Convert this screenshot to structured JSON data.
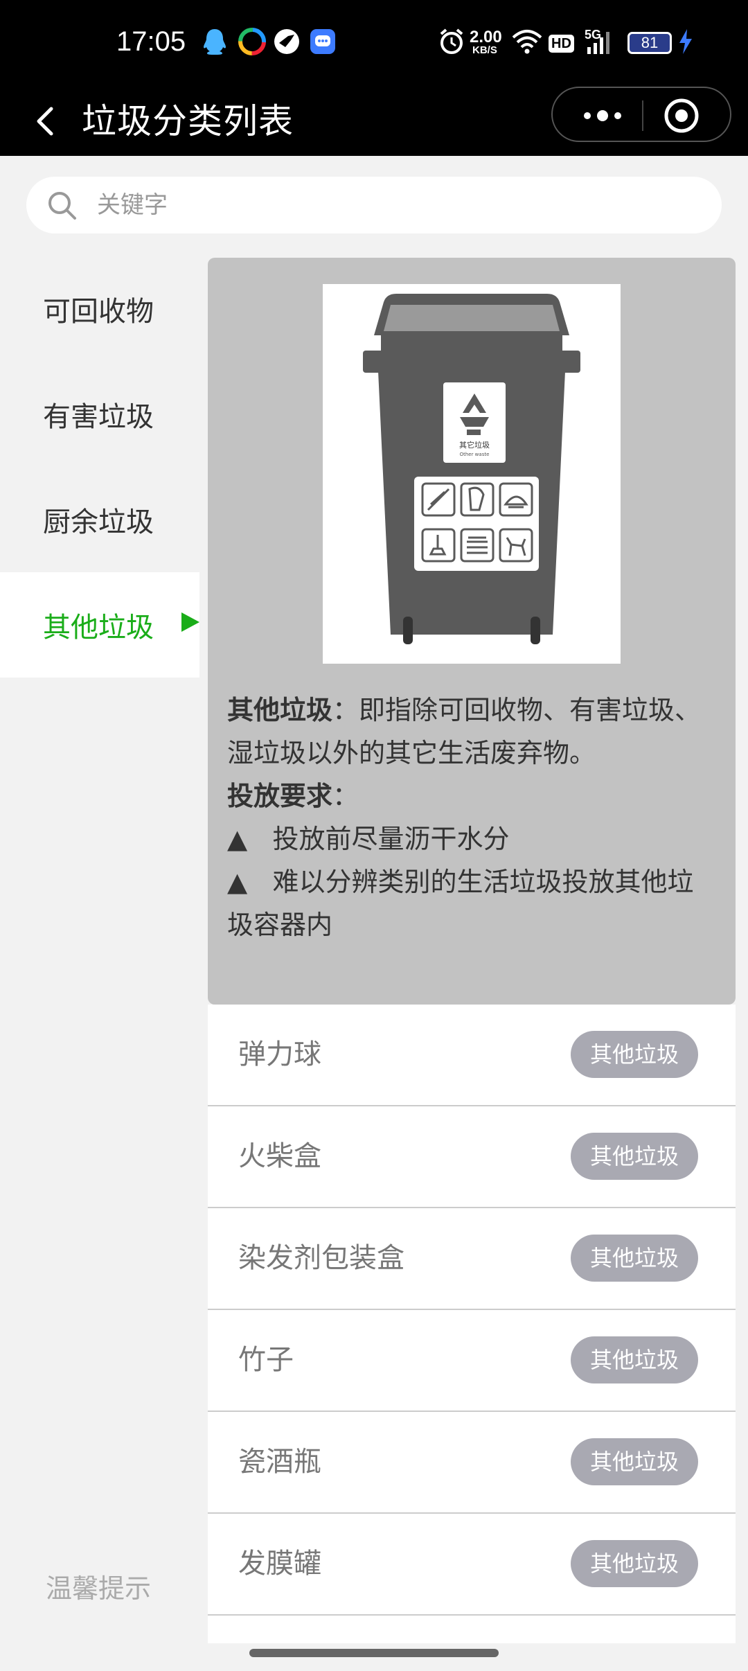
{
  "status_bar": {
    "time": "17:05",
    "net_speed_value": "2.00",
    "net_speed_unit": "KB/S",
    "hd_label": "HD",
    "signal_label": "5G",
    "battery": "81"
  },
  "titlebar": {
    "title": "垃圾分类列表"
  },
  "search": {
    "placeholder": "关键字"
  },
  "sidebar": {
    "items": [
      {
        "label": "可回收物"
      },
      {
        "label": "有害垃圾"
      },
      {
        "label": "厨余垃圾"
      },
      {
        "label": "其他垃圾"
      }
    ],
    "tip": "温馨提示"
  },
  "bin_image": {
    "label_cn": "其它垃圾",
    "label_en": "Other waste"
  },
  "info": {
    "title": "其他垃圾",
    "colon": "：",
    "description": "即指除可回收物、有害垃圾、湿垃圾以外的其它生活废弃物。",
    "req_title": "投放要求",
    "req_colon": "：",
    "bullet": "▲",
    "requirements": [
      "投放前尽量沥干水分",
      "难以分辨类别的生活垃圾投放其他垃圾容器内"
    ]
  },
  "list": {
    "items": [
      {
        "name": "弹力球",
        "tag": "其他垃圾"
      },
      {
        "name": "火柴盒",
        "tag": "其他垃圾"
      },
      {
        "name": "染发剂包装盒",
        "tag": "其他垃圾"
      },
      {
        "name": "竹子",
        "tag": "其他垃圾"
      },
      {
        "name": "瓷酒瓶",
        "tag": "其他垃圾"
      },
      {
        "name": "发膜罐",
        "tag": "其他垃圾"
      }
    ]
  },
  "colors": {
    "accent": "#1aad19",
    "tag_bg": "#a9a9b2",
    "card_bg": "#c2c2c2"
  }
}
